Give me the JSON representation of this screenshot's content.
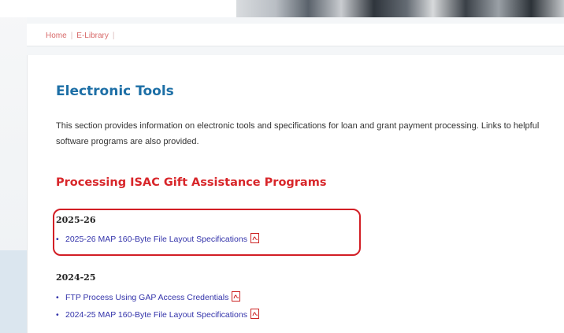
{
  "breadcrumb": {
    "items": [
      "Home",
      "E-Library"
    ]
  },
  "page": {
    "title": "Electronic Tools",
    "intro": "This section provides information on electronic tools and specifications for loan and grant payment processing.  Links to helpful software programs are also provided."
  },
  "section": {
    "title": "Processing ISAC Gift Assistance Programs",
    "years": [
      {
        "label": "2025-26",
        "files": [
          "2025-26 MAP 160-Byte File Layout Specifications"
        ]
      },
      {
        "label": "2024-25",
        "files": [
          "FTP Process Using GAP Access Credentials",
          "2024-25 MAP 160-Byte File Layout Specifications"
        ]
      }
    ]
  },
  "icons": {
    "file": "pdf-icon",
    "bullet": "bullet-dot"
  },
  "colors": {
    "title_blue": "#1d6fa6",
    "section_red": "#d8262a",
    "link": "#3333aa",
    "highlight": "#d21e25"
  }
}
